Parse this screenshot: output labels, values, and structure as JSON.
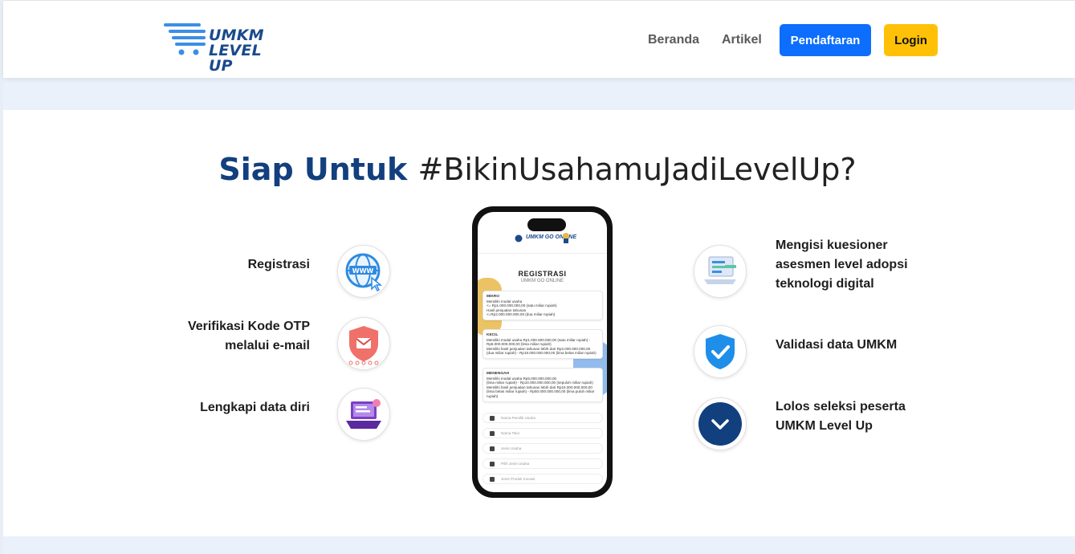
{
  "header": {
    "logo_line1": "UMKM",
    "logo_line2": "LEVEL UP",
    "nav": [
      "Beranda",
      "Artikel"
    ],
    "register_button": "Pendaftaran",
    "login_button": "Login"
  },
  "hero": {
    "title_strong": "Siap Untuk",
    "title_light": "#BikinUsahamuJadiLevelUp?"
  },
  "steps_left": [
    {
      "line1": "Registrasi",
      "line2": "",
      "icon": "globe-www-icon"
    },
    {
      "line1": "Verifikasi Kode OTP",
      "line2": "melalui e-mail",
      "icon": "shield-mail-icon"
    },
    {
      "line1": "Lengkapi data diri",
      "line2": "",
      "icon": "laptop-form-icon"
    }
  ],
  "steps_right": [
    {
      "line1": "Mengisi kuesioner",
      "line2": "asesmen level adopsi",
      "line3": "teknologi digital",
      "icon": "survey-laptop-icon"
    },
    {
      "line1": "Validasi data UMKM",
      "icon": "shield-check-icon"
    },
    {
      "line1": "Lolos seleksi peserta",
      "line2": "UMKM Level Up",
      "icon": "chevron-down-icon"
    }
  ],
  "phone": {
    "logo": "UMKM GO ONLINE",
    "title": "REGISTRASI",
    "subtitle": "UMKM GO ONLINE",
    "cards": [
      {
        "heading": "MIKRO",
        "l1": "Memiliki modal usaha",
        "l2": "<= Rp1.000.000.000,00 (satu miliar rupiah)",
        "l3": "Hasil penjualan tahunan",
        "l4": "<=Rp2.000.000.000,00 (dua miliar rupiah)"
      },
      {
        "heading": "KECIL",
        "l1": "Memiliki modal usaha Rp1.000.000.000,00 (satu miliar rupiah) -",
        "l2": "Rp5.000.000.000,00 (lima miliar rupiah)",
        "l3": "Memiliki hasil penjualan tahunan lebih dari Rp2.000.000.000,00",
        "l4": "(dua miliar rupiah) - Rp15.000.000.000,00 (lima belas miliar rupiah)"
      },
      {
        "heading": "MENENGAH",
        "l1": "Memiliki modal usaha Rp5.000.000.000,00",
        "l2": "(lima miliar rupiah) - Rp10.000.000.000,00 (sepuluh miliar rupiah)",
        "l3": "Memiliki hasil penjualan tahunan lebih dari Rp15.000.000.000,00",
        "l4": "(lima belas miliar rupiah) - Rp50.000.000.000,00 (lima puluh miliar rupiah)"
      }
    ],
    "fields": [
      "Nama Pemilik Usaha",
      "Nama Toko",
      "Jenis Usaha",
      "Pilih Jenis Usaha",
      "Jenis Produk Inovasi"
    ]
  },
  "colors": {
    "primary": "#0d6efd",
    "accent": "#ffc107",
    "brand_dark": "#123f7e",
    "band": "#eaf1fb"
  }
}
